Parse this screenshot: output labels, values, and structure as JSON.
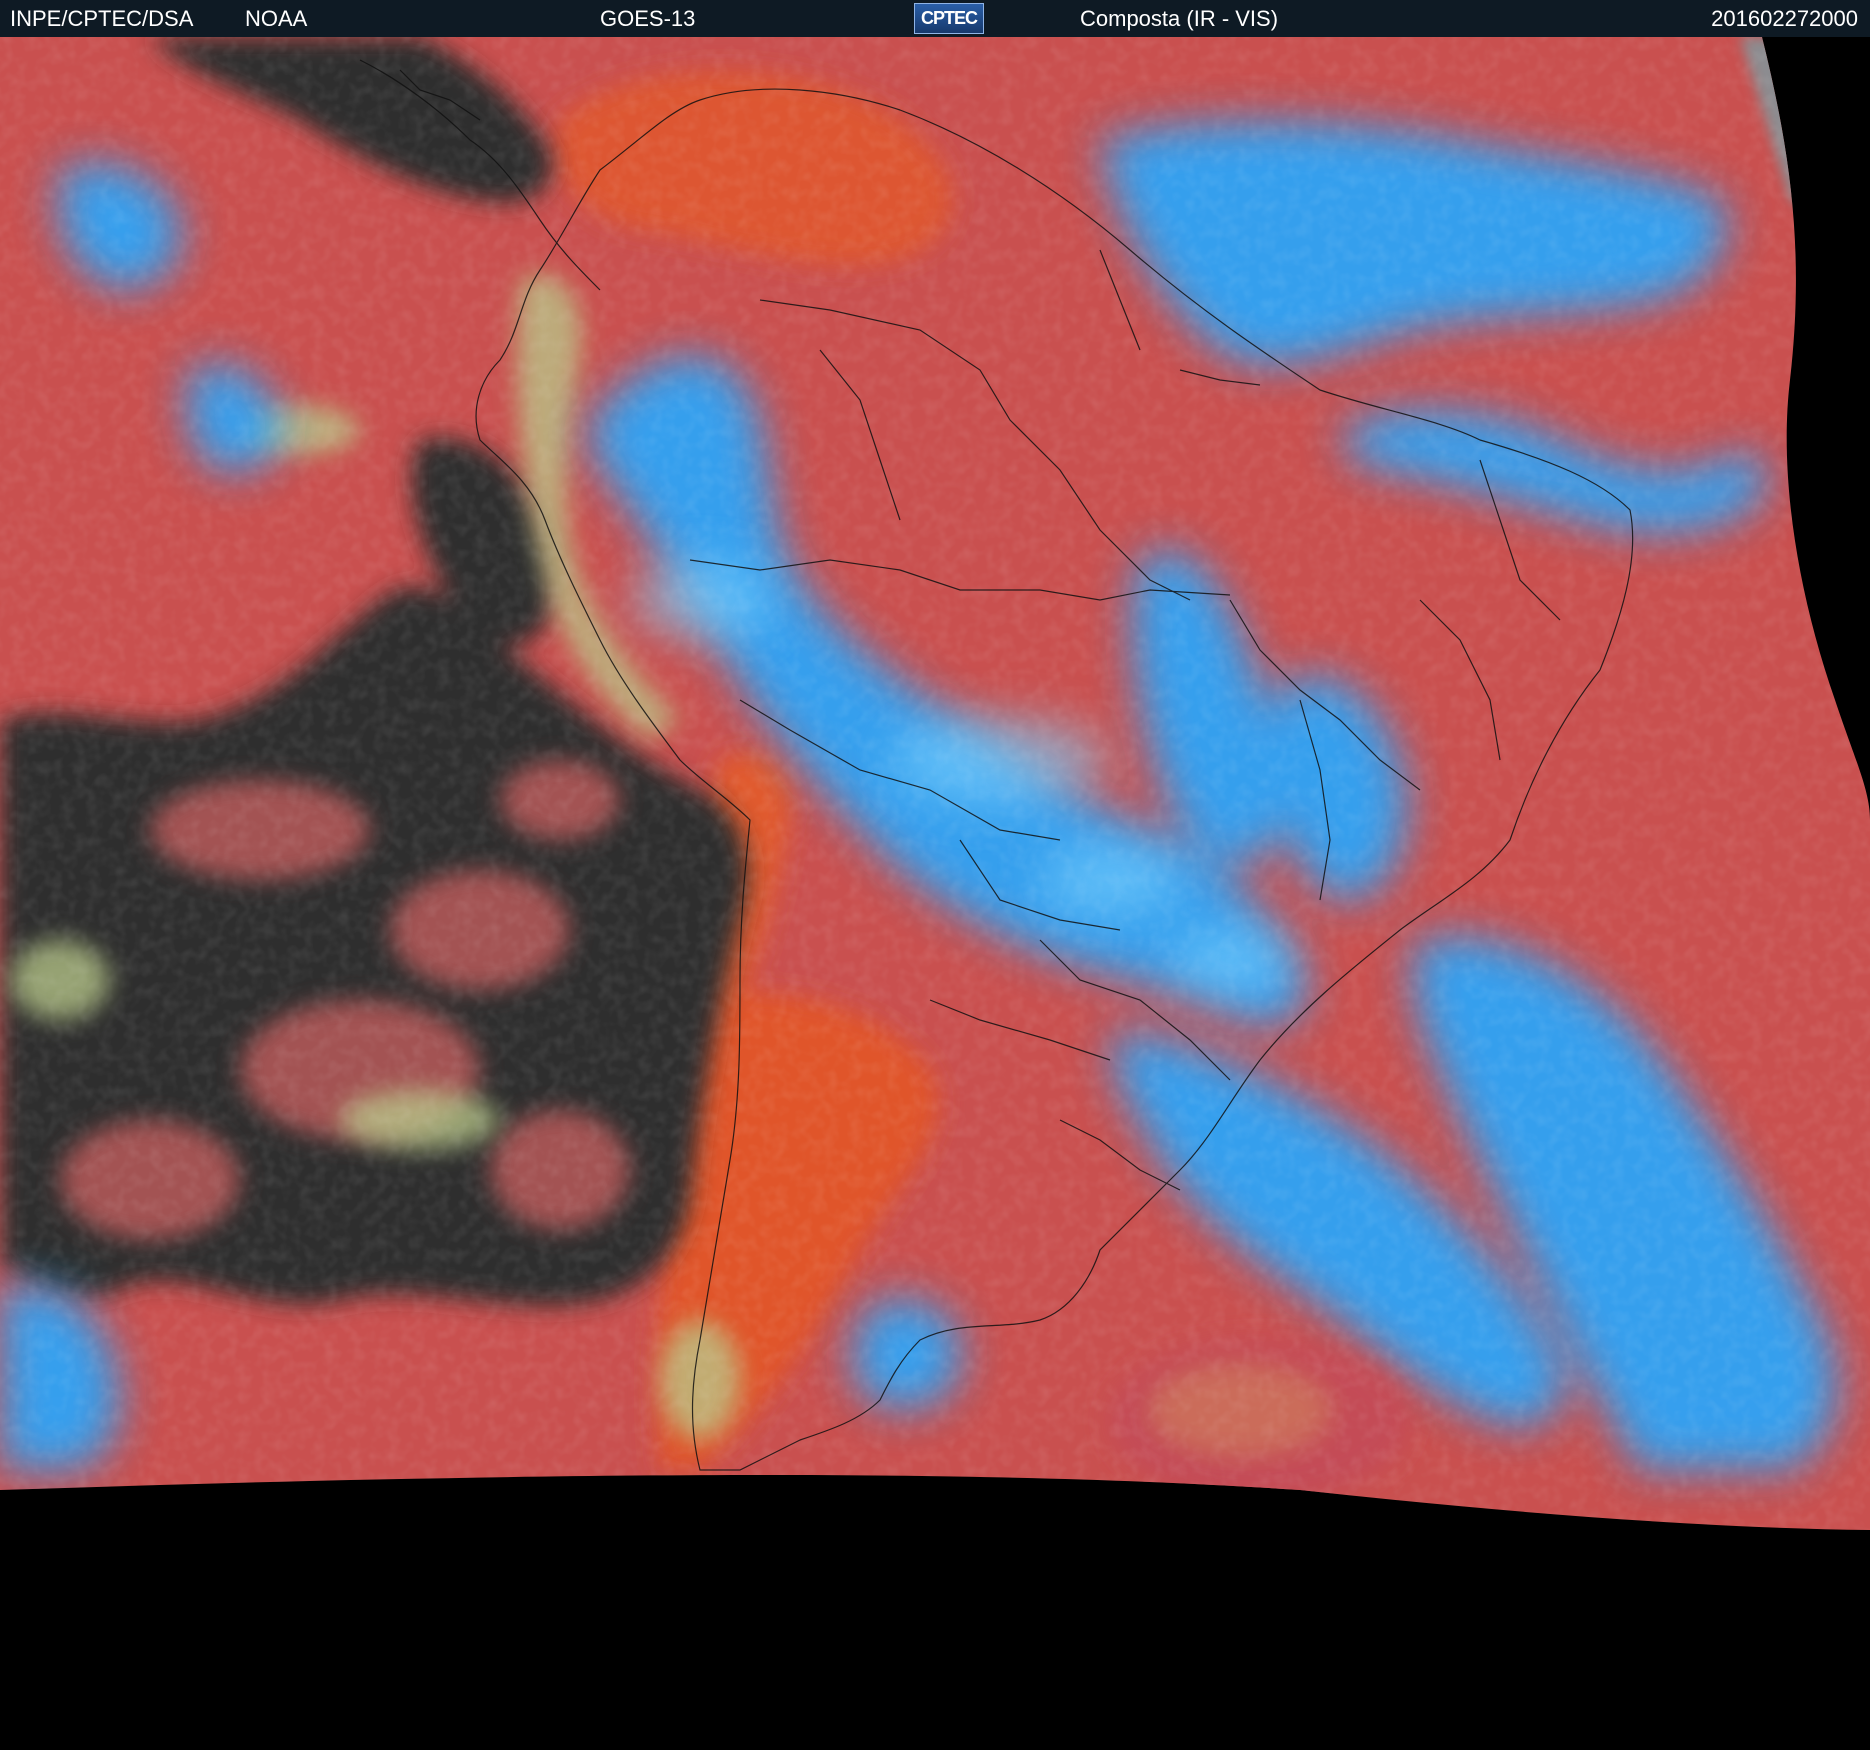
{
  "header": {
    "agency": "INPE/CPTEC/DSA",
    "source": "NOAA",
    "satellite": "GOES-13",
    "logo_text": "CPTEC",
    "product": "Composta (IR - VIS)",
    "timestamp": "201602272000"
  },
  "map": {
    "region": "South America",
    "colors": {
      "clear_surface": "#c9504f",
      "land_warm": "#e2572c",
      "high_clouds": "#2ab0ff",
      "low_clouds": "#2e2e2e",
      "cloud_edges": "#b9c98a",
      "outside_disk": "#000000",
      "border_lines": "#111111"
    }
  }
}
